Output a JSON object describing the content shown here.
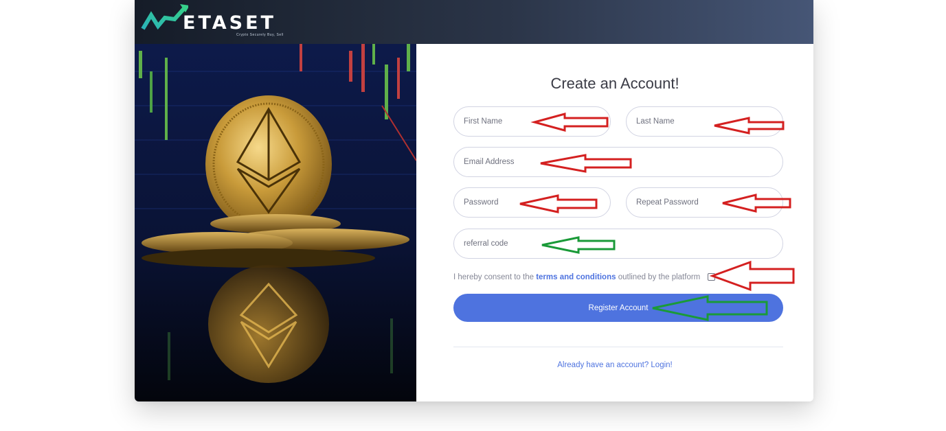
{
  "brand": {
    "name": "ETASET",
    "tagline": "Crypto Securely Buy, Sell"
  },
  "form": {
    "title": "Create an Account!",
    "first_name_placeholder": "First Name",
    "last_name_placeholder": "Last Name",
    "email_placeholder": "Email Address",
    "password_placeholder": "Password",
    "repeat_password_placeholder": "Repeat Password",
    "referral_placeholder": "referral code",
    "consent_prefix": "I hereby consent to the",
    "consent_link": "terms and conditions",
    "consent_suffix": "outlined by the platform",
    "register_label": "Register Account",
    "login_link": "Already have an account? Login!"
  },
  "colors": {
    "accent": "#4e73df",
    "header_dark": "#151c28",
    "header_light": "#465676",
    "logo_teal": "#2bb9b5",
    "annotation_red": "#d42020",
    "annotation_green": "#1a9a38"
  },
  "icons": {
    "logo_mark": "rising-arrow-m-icon",
    "hero_image": "ethereum-coin-image"
  }
}
